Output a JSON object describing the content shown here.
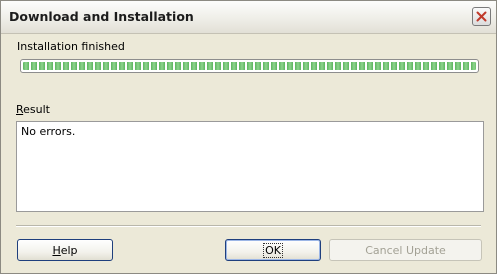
{
  "window": {
    "title": "Download and Installation"
  },
  "status": {
    "label": "Installation finished",
    "progress_percent": 100
  },
  "result": {
    "label_first_letter": "R",
    "label_rest": "esult",
    "text": "No errors."
  },
  "buttons": {
    "help_first_letter": "H",
    "help_rest": "elp",
    "ok_label": "OK",
    "cancel_update_label": "Cancel Update"
  },
  "colors": {
    "progress": "#5bb55e",
    "close_x": "#c0392b"
  }
}
